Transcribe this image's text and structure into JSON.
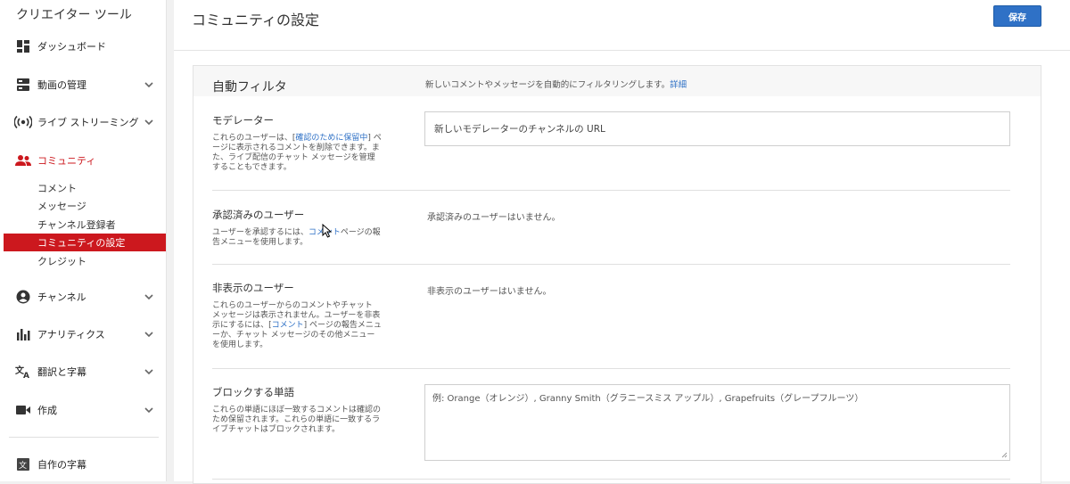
{
  "sidebar": {
    "title": "クリエイター ツール",
    "items": [
      {
        "label": "ダッシュボード",
        "icon": "dashboard-icon"
      },
      {
        "label": "動画の管理",
        "icon": "video-manager-icon"
      },
      {
        "label": "ライブ ストリーミング",
        "icon": "live-streaming-icon"
      },
      {
        "label": "コミュニティ",
        "icon": "community-icon"
      },
      {
        "label": "チャンネル",
        "icon": "channel-icon"
      },
      {
        "label": "アナリティクス",
        "icon": "analytics-icon"
      },
      {
        "label": "翻訳と字幕",
        "icon": "translate-icon"
      },
      {
        "label": "作成",
        "icon": "create-icon"
      },
      {
        "label": "自作の字幕",
        "icon": "subtitles-icon"
      }
    ],
    "community_sub": [
      "コメント",
      "メッセージ",
      "チャンネル登録者",
      "コミュニティの設定",
      "クレジット"
    ],
    "selected_sub": "コミュニティの設定"
  },
  "header": {
    "title": "コミュニティの設定",
    "save_label": "保存"
  },
  "filters": {
    "title": "自動フィルタ",
    "desc": "新しいコメントやメッセージを自動的にフィルタリングします。",
    "details_link": "詳細",
    "moderators": {
      "title": "モデレーター",
      "desc_pre": "これらのユーザーは、[",
      "desc_link": "確認のために保留中",
      "desc_post": "] ページに表示されるコメントを削除できます。また、ライブ配信のチャット メッセージを管理することもできます。",
      "input_value": "新しいモデレーターのチャンネルの URL"
    },
    "approved": {
      "title": "承認済みのユーザー",
      "desc_pre": "ユーザーを承認するには、",
      "desc_link": "コメント",
      "desc_post": "ページの報告メニューを使用します。",
      "value": "承認済みのユーザーはいません。"
    },
    "hidden": {
      "title": "非表示のユーザー",
      "desc_pre": "これらのユーザーからのコメントやチャット メッセージは表示されません。ユーザーを非表示にするには、[",
      "desc_link": "コメント",
      "desc_post": "] ページの報告メニューか、チャット メッセージのその他メニューを使用します。",
      "value": "非表示のユーザーはいません。"
    },
    "blocked": {
      "title": "ブロックする単語",
      "desc": "これらの単語にほぼ一致するコメントは確認のため保留されます。これらの単語に一致するライブチャットはブロックされます。",
      "placeholder": "例: Orange（オレンジ）, Granny Smith（グラニースミス アップル）, Grapefruits（グレープフルーツ）"
    }
  },
  "colors": {
    "accent_red": "#cc181e",
    "link_blue": "#2f71c6",
    "save_blue": "#2f71c6"
  }
}
